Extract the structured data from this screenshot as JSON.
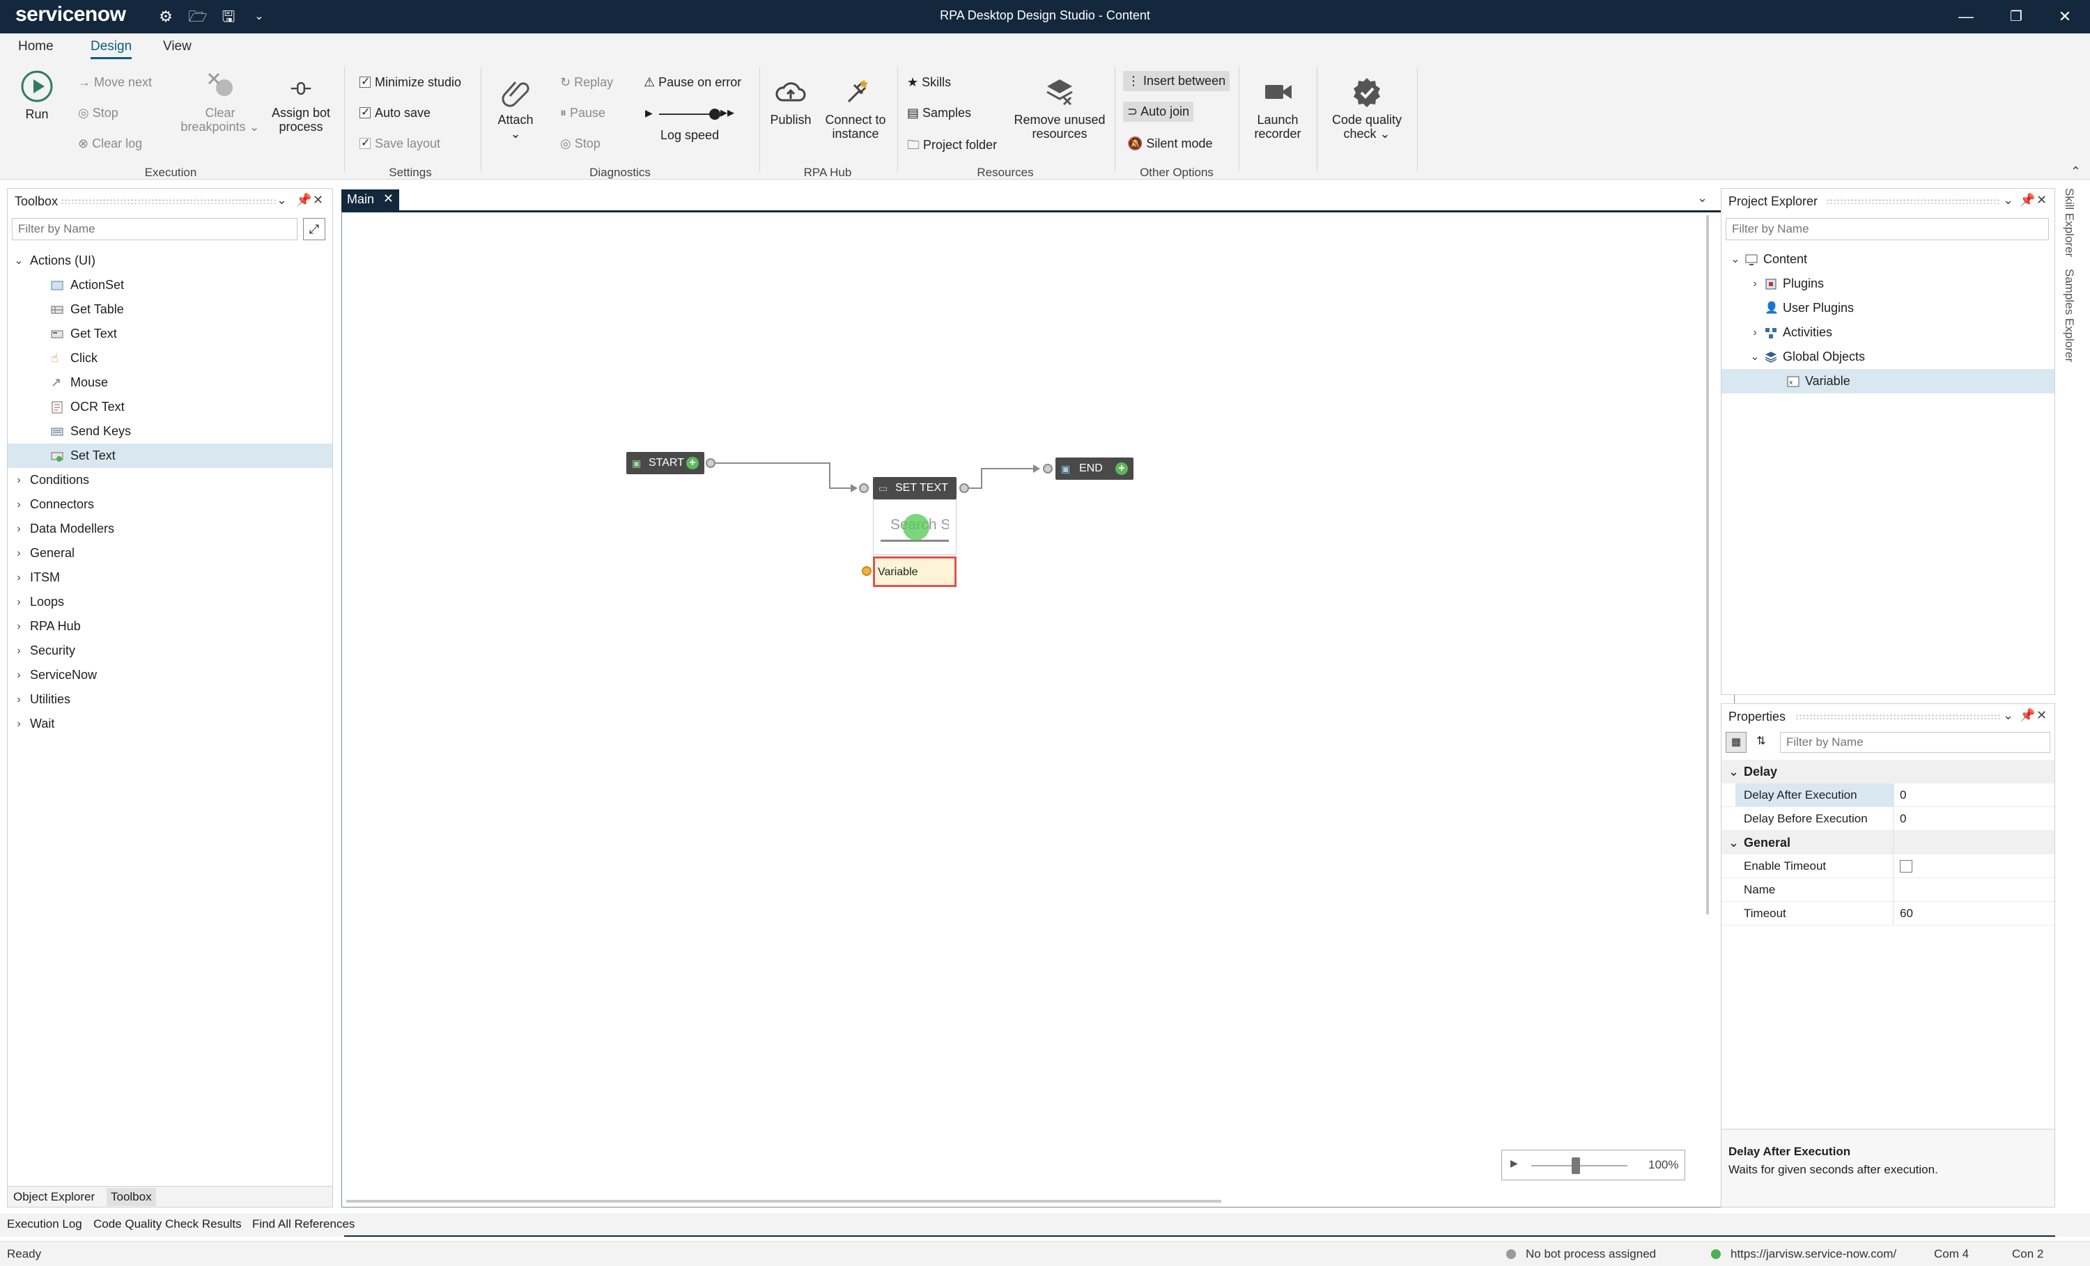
{
  "app": {
    "brand": "servicenow",
    "window_title": "RPA Desktop Design Studio - Content"
  },
  "ribbon_tabs": [
    "Home",
    "Design",
    "View"
  ],
  "ribbon": {
    "execution": {
      "run": "Run",
      "move_next": "Move next",
      "stop": "Stop",
      "clear_log": "Clear log",
      "clear_breakpoints": "Clear breakpoints",
      "assign_bot_process": "Assign bot process",
      "group": "Execution"
    },
    "settings": {
      "minimize_studio": "Minimize studio",
      "auto_save": "Auto save",
      "save_layout": "Save layout",
      "group": "Settings"
    },
    "diagnostics": {
      "attach": "Attach",
      "replay": "Replay",
      "pause": "Pause",
      "stop": "Stop",
      "pause_on_error": "Pause on error",
      "log_speed": "Log speed",
      "group": "Diagnostics"
    },
    "rpa_hub": {
      "publish": "Publish",
      "connect_to_instance": "Connect to instance",
      "group": "RPA Hub"
    },
    "resources": {
      "skills": "Skills",
      "samples": "Samples",
      "project_folder": "Project folder",
      "remove_unused": "Remove unused resources",
      "group": "Resources"
    },
    "other_options": {
      "insert_between": "Insert between",
      "auto_join": "Auto join",
      "silent_mode": "Silent mode",
      "group": "Other Options"
    },
    "launch_recorder": "Launch recorder",
    "code_quality_check": "Code quality check"
  },
  "toolbox": {
    "title": "Toolbox",
    "filter_placeholder": "Filter by Name",
    "expanded_group": "Actions (UI)",
    "actions": [
      "ActionSet",
      "Get Table",
      "Get Text",
      "Click",
      "Mouse",
      "OCR Text",
      "Send Keys",
      "Set Text"
    ],
    "selected_action": "Set Text",
    "groups": [
      "Conditions",
      "Connectors",
      "Data Modellers",
      "General",
      "ITSM",
      "Loops",
      "RPA Hub",
      "Security",
      "ServiceNow",
      "Utilities",
      "Wait"
    ],
    "bottom_tabs": [
      "Object Explorer",
      "Toolbox"
    ]
  },
  "document": {
    "tab": "Main",
    "nodes": {
      "start": "START",
      "set_text": "SET TEXT",
      "set_text_field": "Search S",
      "variable": "Variable",
      "end": "END"
    },
    "zoom": "100%"
  },
  "project_explorer": {
    "title": "Project Explorer",
    "filter_placeholder": "Filter by Name",
    "items": [
      "Content",
      "Plugins",
      "User Plugins",
      "Activities",
      "Global Objects",
      "Variable"
    ],
    "selected": "Variable"
  },
  "side_tabs": [
    "Skill Explorer",
    "Samples Explorer"
  ],
  "properties": {
    "title": "Properties",
    "filter_placeholder": "Filter by Name",
    "categories": [
      {
        "name": "Delay",
        "rows": [
          {
            "key": "Delay After Execution",
            "value": "0"
          },
          {
            "key": "Delay Before Execution",
            "value": "0"
          }
        ]
      },
      {
        "name": "General",
        "rows": [
          {
            "key": "Enable Timeout",
            "value": ""
          },
          {
            "key": "Name",
            "value": ""
          },
          {
            "key": "Timeout",
            "value": "60"
          }
        ]
      }
    ],
    "description_title": "Delay After Execution",
    "description_text": "Waits for given seconds after execution."
  },
  "output_tabs": [
    "Execution Log",
    "Code Quality Check Results",
    "Find All References"
  ],
  "status": {
    "ready": "Ready",
    "bot_process": "No bot process assigned",
    "instance_url": "https://jarvisw.service-now.com/",
    "com": "Com 4",
    "con": "Con 2"
  },
  "colors": {
    "titlebar": "#13283c",
    "accent": "#0b5c87",
    "node": "#4a4a4a",
    "add_green": "#5cb85c",
    "variable_fill": "#fdf3d8",
    "variable_border": "#e05252"
  }
}
